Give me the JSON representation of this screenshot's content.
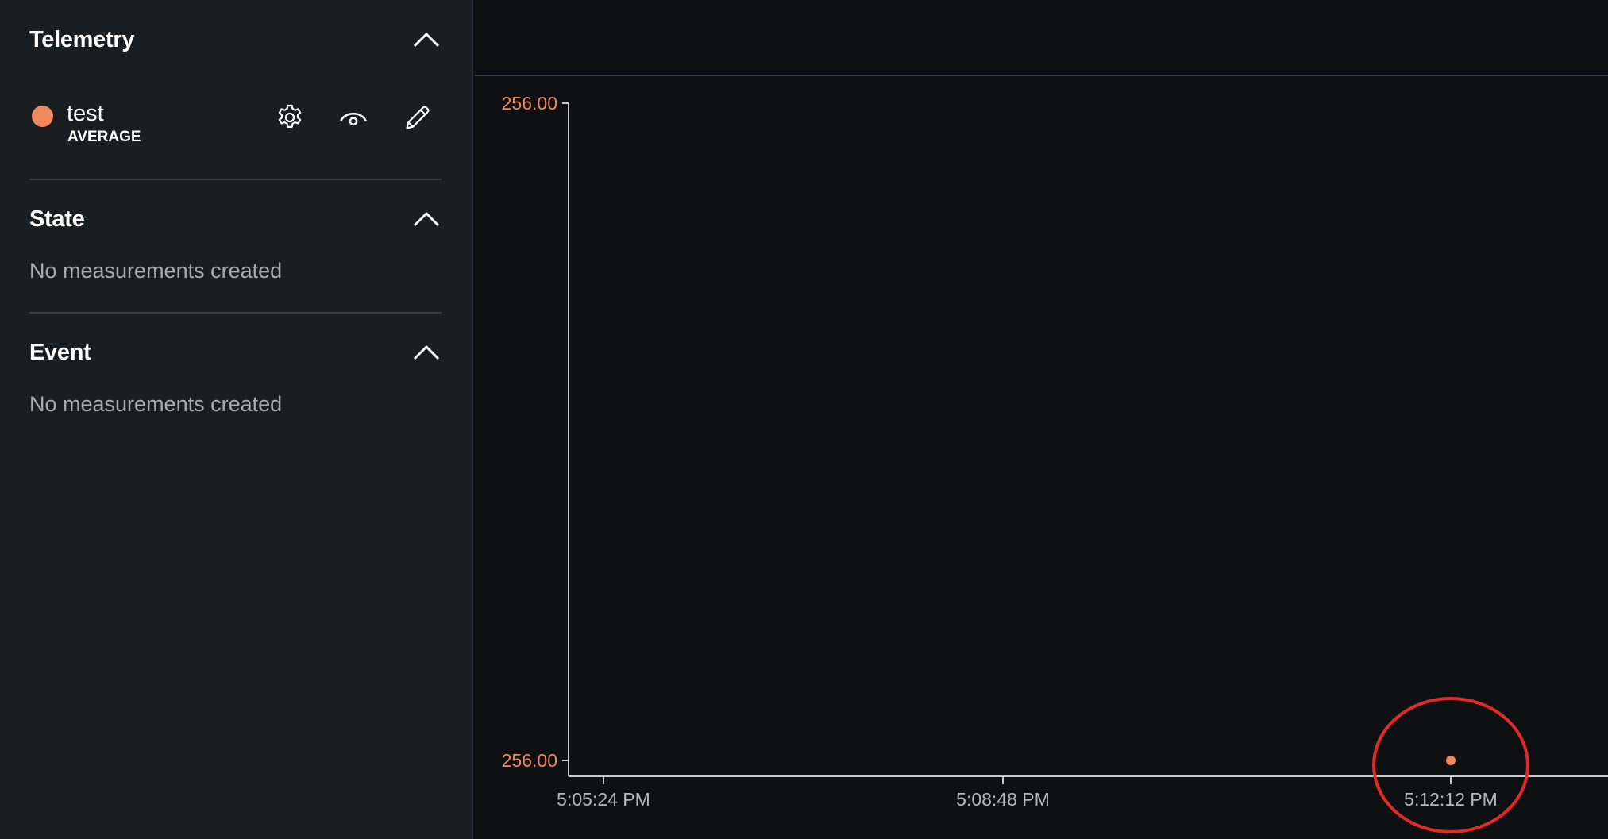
{
  "sidebar": {
    "telemetry": {
      "title": "Telemetry",
      "items": [
        {
          "name": "test",
          "aggregation": "AVERAGE",
          "color": "#f08a5d",
          "actions": [
            "gear-icon",
            "eye-icon",
            "pencil-icon"
          ]
        }
      ]
    },
    "state": {
      "title": "State",
      "empty_text": "No measurements created"
    },
    "event": {
      "title": "Event",
      "empty_text": "No measurements created"
    }
  },
  "colors": {
    "series": "#f08a5d",
    "annotation": "#e22a2a",
    "axis": "#c9cbcd"
  },
  "chart_data": {
    "type": "scatter",
    "title": "",
    "xlabel": "",
    "ylabel": "",
    "x_ticks": [
      "5:05:24 PM",
      "5:08:48 PM",
      "5:12:12 PM"
    ],
    "y_ticks": [
      "256.00",
      "256.00"
    ],
    "series": [
      {
        "x": [
          "5:12:12 PM"
        ],
        "y": [
          256.0
        ]
      }
    ],
    "annotations": [
      "red circle around the single data point"
    ],
    "grid": false
  }
}
